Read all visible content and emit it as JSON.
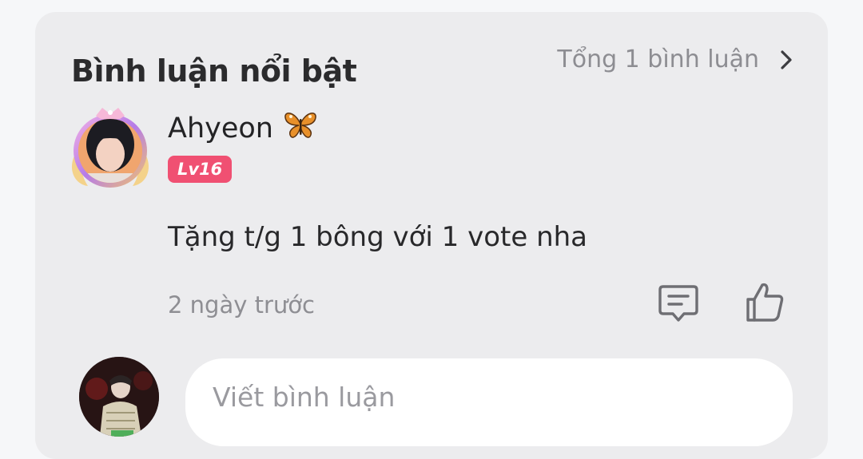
{
  "section": {
    "title": "Bình luận nổi bật",
    "total_label": "Tổng 1 bình luận"
  },
  "comment": {
    "author": "Ahyeon",
    "author_emoji": "🦋",
    "level": "Lv16",
    "text": "Tặng t/g 1 bông với 1 vote nha",
    "time": "2 ngày trước"
  },
  "composer": {
    "placeholder": "Viết bình luận"
  },
  "colors": {
    "card_bg": "#ececee",
    "level_badge": "#f05072",
    "muted_text": "#8e8e93"
  },
  "icons": {
    "more": "chevron-right-icon",
    "reply": "comment-bubble-icon",
    "like": "thumbs-up-icon"
  }
}
